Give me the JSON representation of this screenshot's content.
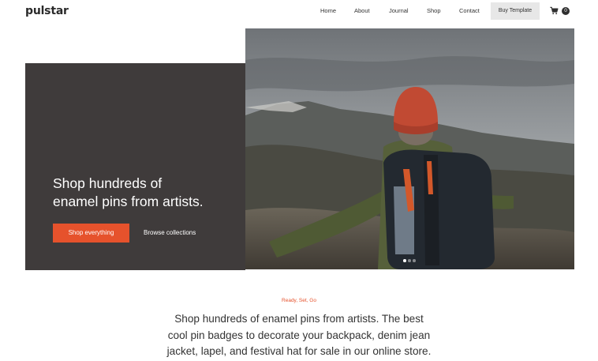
{
  "header": {
    "logo": "pulstar",
    "nav": [
      "Home",
      "About",
      "Journal",
      "Shop",
      "Contact"
    ],
    "buy_label": "Buy Template",
    "cart_count": "0"
  },
  "hero": {
    "heading_lines": [
      "Shop hundreds of",
      "enamel pins from artists."
    ],
    "primary_cta": "Shop everything",
    "secondary_cta": "Browse collections",
    "slides": {
      "count": 3,
      "active": 1
    }
  },
  "intro": {
    "eyebrow": "Ready, Set, Go",
    "lines": [
      "Shop hundreds of enamel pins from artists. The best",
      "cool pin badges to decorate your backpack, denim jean",
      "jacket, lapel, and festival hat for sale in our online store."
    ]
  },
  "colors": {
    "accent": "#e6522c",
    "panel": "#3f3b3b",
    "buy_button_bg": "#e7e7e7"
  }
}
